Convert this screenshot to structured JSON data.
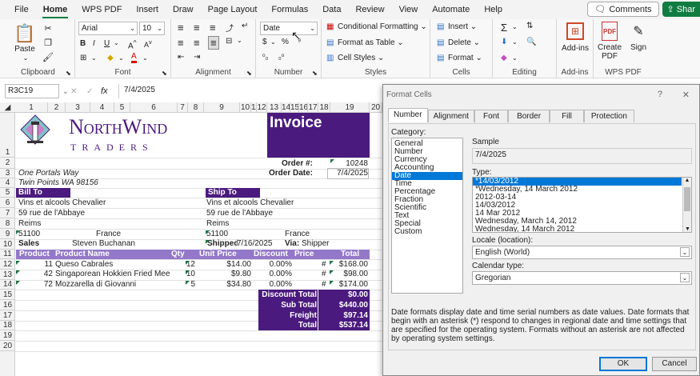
{
  "tabs": [
    "File",
    "Home",
    "WPS PDF",
    "Insert",
    "Draw",
    "Page Layout",
    "Formulas",
    "Data",
    "Review",
    "View",
    "Automate",
    "Help"
  ],
  "comments_label": "Comments",
  "share_label": "Shar",
  "ribbon": {
    "paste": "Paste",
    "clipboard": "Clipboard",
    "font_name": "Arial",
    "font_size": "10",
    "font": "Font",
    "alignment": "Alignment",
    "number_format": "Date",
    "number": "Number",
    "cond_fmt": "Conditional Formatting",
    "fmt_table": "Format as Table",
    "cell_styles": "Cell Styles",
    "styles": "Styles",
    "insert": "Insert",
    "delete": "Delete",
    "format": "Format",
    "cells": "Cells",
    "editing": "Editing",
    "addins": "Add-ins",
    "addins_grp": "Add-ins",
    "create_pdf": "Create PDF",
    "sign": "Sign",
    "wpspdf": "WPS PDF"
  },
  "formula": {
    "namebox": "R3C19",
    "fx": "fx",
    "value": "7/4/2025"
  },
  "columns": [
    "1",
    "2",
    "3",
    "4",
    "5",
    "6",
    "7",
    "8",
    "9",
    "10",
    "11",
    "12",
    "13",
    "14",
    "15",
    "16",
    "17",
    "18",
    "19",
    "20"
  ],
  "rows": [
    "1",
    "2",
    "3",
    "4",
    "5",
    "6",
    "7",
    "8",
    "9",
    "10",
    "11",
    "12",
    "13",
    "14",
    "15",
    "16",
    "17",
    "18",
    "19",
    "20"
  ],
  "sheet": {
    "logo_line1": "NorthWind",
    "logo_line2": "TRADERS",
    "invoice": "Invoice",
    "order_no_label": "Order #:",
    "order_no": "10248",
    "order_date_label": "Order Date:",
    "order_date": "7/4/2025",
    "addr1": "One Portals Way",
    "addr2": "Twin Points WA  98156",
    "bill_to": "Bill To",
    "ship_to": "Ship To",
    "bill_name": "Vins et alcools Chevalier",
    "bill_street": "59 rue de l'Abbaye",
    "bill_city": "Reims",
    "bill_zip": "51100",
    "bill_country": "France",
    "ship_name": "Vins et alcools Chevalier",
    "ship_street": "59 rue de l'Abbaye",
    "ship_city": "Reims",
    "ship_zip": "51100",
    "ship_country": "France",
    "sales_label": "Sales",
    "sales_person": "Steven Buchanan",
    "shipped_label": "Shipped",
    "shipped_date": "7/16/2025",
    "via_label": "Via:",
    "via": "Shipper",
    "h_product": "Product",
    "h_name": "Product Name",
    "h_qty": "Qty",
    "h_price": "Unit Price",
    "h_discount": "Discount",
    "h_price2": "Price",
    "h_total": "Total",
    "items": [
      {
        "id": "11",
        "name": "Queso Cabrales",
        "qty": "12",
        "price": "$14.00",
        "disc": "0.00%",
        "hash": "#",
        "total": "$168.00"
      },
      {
        "id": "42",
        "name": "Singaporean Hokkien Fried Mee",
        "qty": "10",
        "price": "$9.80",
        "disc": "0.00%",
        "hash": "#",
        "total": "$98.00"
      },
      {
        "id": "72",
        "name": "Mozzarella di Giovanni",
        "qty": "5",
        "price": "$34.80",
        "disc": "0.00%",
        "hash": "#",
        "total": "$174.00"
      }
    ],
    "disc_total_label": "Discount Total",
    "disc_total": "$0.00",
    "subtotal_label": "Sub Total",
    "subtotal": "$440.00",
    "freight_label": "Freight",
    "freight": "$97.14",
    "total_label": "Total",
    "total": "$537.14"
  },
  "dialog": {
    "title": "Format Cells",
    "help": "?",
    "close": "✕",
    "tabs": [
      "Number",
      "Alignment",
      "Font",
      "Border",
      "Fill",
      "Protection"
    ],
    "category_label": "Category:",
    "categories": [
      "General",
      "Number",
      "Currency",
      "Accounting",
      "Date",
      "Time",
      "Percentage",
      "Fraction",
      "Scientific",
      "Text",
      "Special",
      "Custom"
    ],
    "sample_label": "Sample",
    "sample": "7/4/2025",
    "type_label": "Type:",
    "types": [
      "*14/03/2012",
      "*Wednesday, 14 March 2012",
      "2012-03-14",
      "14/03/2012",
      "14 Mar 2012",
      "Wednesday, March 14, 2012",
      "Wednesday, 14 March 2012"
    ],
    "locale_label": "Locale (location):",
    "locale": "English (World)",
    "calendar_label": "Calendar type:",
    "calendar": "Gregorian",
    "desc": "Date formats display date and time serial numbers as date values.  Date formats that begin with an asterisk (*) respond to changes in regional date and time settings that are specified for the operating system. Formats without an asterisk are not affected by operating system settings.",
    "ok": "OK",
    "cancel": "Cancel"
  },
  "colors": {
    "purple": "#4b1a7e",
    "lavender": "#9378c9",
    "excel_green": "#107c41",
    "select_blue": "#0078d7"
  }
}
